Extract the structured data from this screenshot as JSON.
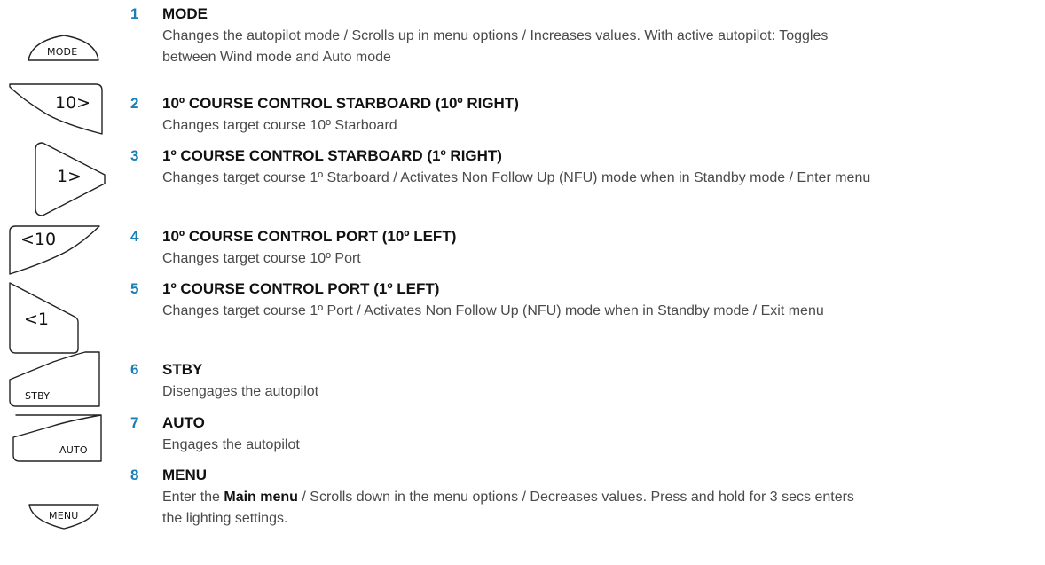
{
  "colors": {
    "number": "#1a7fb6",
    "title": "#111111",
    "text": "#4a4a4a",
    "key_outline": "#222222"
  },
  "keys": {
    "mode": {
      "label": "MODE",
      "icon": "mode-key-icon"
    },
    "starboard10": {
      "label": "10>",
      "icon": "course-10-starboard-key-icon"
    },
    "starboard1": {
      "label": "1>",
      "icon": "course-1-starboard-key-icon"
    },
    "port10": {
      "label": "<10",
      "icon": "course-10-port-key-icon"
    },
    "port1": {
      "label": "<1",
      "icon": "course-1-port-key-icon"
    },
    "stby": {
      "label": "STBY",
      "icon": "stby-key-icon"
    },
    "auto": {
      "label": "AUTO",
      "icon": "auto-key-icon"
    },
    "menu": {
      "label": "MENU",
      "icon": "menu-key-icon"
    }
  },
  "items": [
    {
      "number": "1",
      "title": "MODE",
      "description": "Changes the autopilot mode / Scrolls up in menu options / Increases values. With active autopilot: Toggles between Wind mode and Auto mode"
    },
    {
      "number": "2",
      "title": "10º COURSE CONTROL STARBOARD (10º RIGHT)",
      "description": "Changes target course 10º Starboard"
    },
    {
      "number": "3",
      "title": "1º COURSE CONTROL STARBOARD (1º RIGHT)",
      "description": "Changes target course 1º Starboard / Activates Non Follow Up (NFU) mode when in Standby mode / Enter menu"
    },
    {
      "number": "4",
      "title": "10º COURSE CONTROL PORT (10º LEFT)",
      "description": "Changes target course 10º Port"
    },
    {
      "number": "5",
      "title": "1º COURSE CONTROL PORT (1º LEFT)",
      "description": "Changes target course 1º Port / Activates Non Follow Up (NFU) mode when in Standby mode / Exit menu"
    },
    {
      "number": "6",
      "title": "STBY",
      "description": "Disengages the autopilot"
    },
    {
      "number": "7",
      "title": "AUTO",
      "description": "Engages the autopilot"
    },
    {
      "number": "8",
      "title": "MENU",
      "description_pre": "Enter the ",
      "description_bold": "Main menu",
      "description_post": " / Scrolls down in the menu options / Decreases values. Press and hold for 3 secs enters the lighting settings."
    }
  ]
}
